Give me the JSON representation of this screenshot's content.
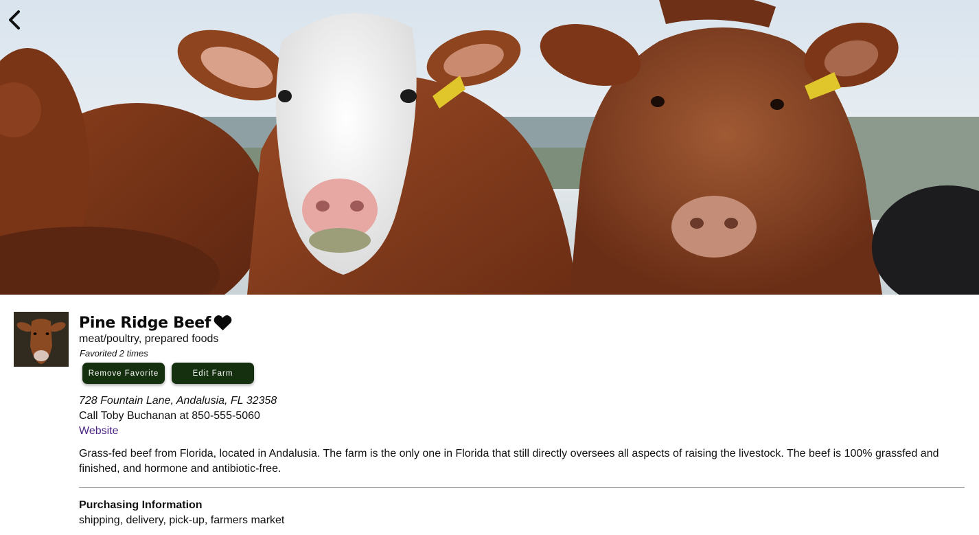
{
  "farm": {
    "name": "Pine Ridge Beef",
    "categories": "meat/poultry, prepared foods",
    "favorited_text": "Favorited 2 times",
    "is_favorited": true,
    "address": "728 Fountain Lane, Andalusia, FL 32358",
    "contact": "Call Toby Buchanan at 850-555-5060",
    "website_label": "Website",
    "description": "Grass-fed beef from Florida, located in Andalusia. The farm is the only one in Florida that still directly oversees all aspects of raising the livestock. The beef is 100% grassfed and finished, and hormone and antibiotic-free."
  },
  "actions": {
    "remove_favorite_label": "Remove Favorite",
    "edit_farm_label": "Edit Farm"
  },
  "purchasing": {
    "heading": "Purchasing Information",
    "methods": "shipping, delivery, pick-up, farmers market"
  },
  "icons": {
    "back": "chevron-left-icon",
    "favorite": "heart-icon"
  },
  "colors": {
    "button_bg": "#15300f",
    "button_text": "#ffffff",
    "link": "#4b2585",
    "divider": "#8a8a8a"
  }
}
